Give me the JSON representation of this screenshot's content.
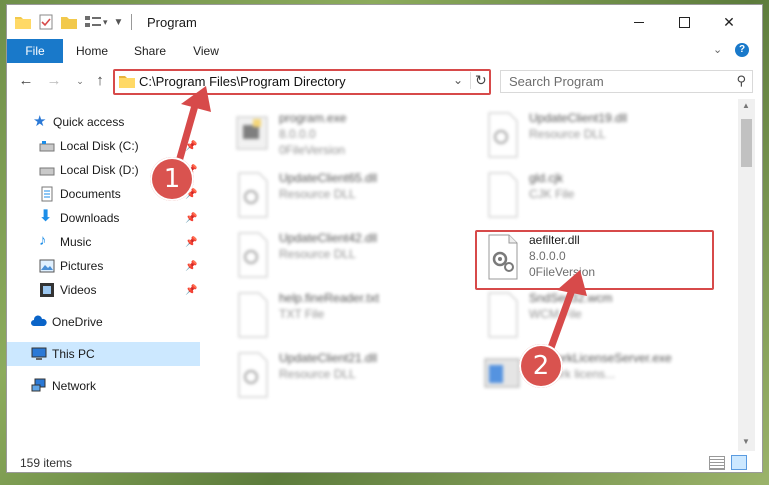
{
  "window": {
    "title": "Program"
  },
  "ribbon": {
    "tabs": [
      "File",
      "Home",
      "Share",
      "View"
    ]
  },
  "address": {
    "path": "C:\\Program Files\\Program Directory"
  },
  "search": {
    "placeholder": "Search Program"
  },
  "sidebar": {
    "items": [
      {
        "label": "Quick access",
        "icon": "star-icon",
        "pinned": false
      },
      {
        "label": "Local Disk (C:)",
        "icon": "drive-icon",
        "pinned": true
      },
      {
        "label": "Local Disk (D:)",
        "icon": "drive-icon",
        "pinned": true
      },
      {
        "label": "Documents",
        "icon": "documents-icon",
        "pinned": true
      },
      {
        "label": "Downloads",
        "icon": "download-icon",
        "pinned": true
      },
      {
        "label": "Music",
        "icon": "music-icon",
        "pinned": true
      },
      {
        "label": "Pictures",
        "icon": "pictures-icon",
        "pinned": true
      },
      {
        "label": "Videos",
        "icon": "videos-icon",
        "pinned": true
      },
      {
        "label": "OneDrive",
        "icon": "cloud-icon",
        "pinned": false
      },
      {
        "label": "This PC",
        "icon": "computer-icon",
        "pinned": false
      },
      {
        "label": "Network",
        "icon": "network-icon",
        "pinned": false
      }
    ]
  },
  "files": [
    {
      "name": "program.exe",
      "line1": "8.0.0.0",
      "line2": "0FileVersion"
    },
    {
      "name": "UpdateClient19.dll",
      "line1": "Resource DLL",
      "line2": ""
    },
    {
      "name": "UpdateClient65.dll",
      "line1": "Resource DLL",
      "line2": ""
    },
    {
      "name": "gld.cjk",
      "line1": "CJK File",
      "line2": ""
    },
    {
      "name": "UpdateClient42.dll",
      "line1": "Resource DLL",
      "line2": ""
    },
    {
      "name": "aefilter.dll",
      "line1": "8.0.0.0",
      "line2": "0FileVersion"
    },
    {
      "name": "help.fineReader.txt",
      "line1": "TXT File",
      "line2": ""
    },
    {
      "name": "SndSec32.wcm",
      "line1": "WCM File",
      "line2": ""
    },
    {
      "name": "UpdateClient21.dll",
      "line1": "Resource DLL",
      "line2": ""
    },
    {
      "name": "NetworkLicenseServer.exe",
      "line1": "network licens...",
      "line2": ""
    }
  ],
  "status": {
    "items": "159 items"
  },
  "callouts": {
    "one": "1",
    "two": "2"
  },
  "colors": {
    "accent": "#1979ca",
    "annotation": "#d74a4a",
    "selected": "#cce8ff"
  }
}
